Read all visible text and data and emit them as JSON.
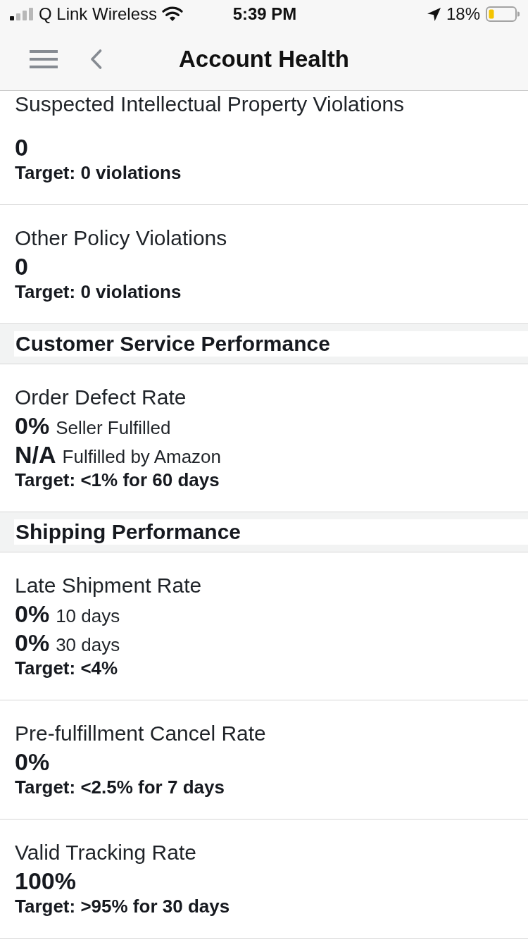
{
  "status_bar": {
    "carrier": "Q Link Wireless",
    "time": "5:39 PM",
    "battery": "18%"
  },
  "nav_bar": {
    "title": "Account Health"
  },
  "sections": [
    {
      "metrics": [
        {
          "title": "Suspected Intellectual Property Violations",
          "values": [
            {
              "value": "0"
            }
          ],
          "target": "Target: 0 violations"
        },
        {
          "title": "Other Policy Violations",
          "values": [
            {
              "value": "0"
            }
          ],
          "target": "Target: 0 violations"
        }
      ]
    },
    {
      "heading": "Customer Service Performance",
      "metrics": [
        {
          "title": "Order Defect Rate",
          "values": [
            {
              "value": "0%",
              "scope": "Seller Fulfilled"
            },
            {
              "value": "N/A",
              "scope": "Fulfilled by Amazon"
            }
          ],
          "target": "Target: <1% for 60 days"
        }
      ]
    },
    {
      "heading": "Shipping Performance",
      "metrics": [
        {
          "title": "Late Shipment Rate",
          "values": [
            {
              "value": "0%",
              "scope": "10 days"
            },
            {
              "value": "0%",
              "scope": "30 days"
            }
          ],
          "target": "Target: <4%"
        },
        {
          "title": "Pre-fulfillment Cancel Rate",
          "values": [
            {
              "value": "0%"
            }
          ],
          "target": "Target: <2.5% for 7 days"
        },
        {
          "title": "Valid Tracking Rate",
          "values": [
            {
              "value": "100%"
            }
          ],
          "target": "Target: >95% for 30 days"
        }
      ]
    }
  ]
}
